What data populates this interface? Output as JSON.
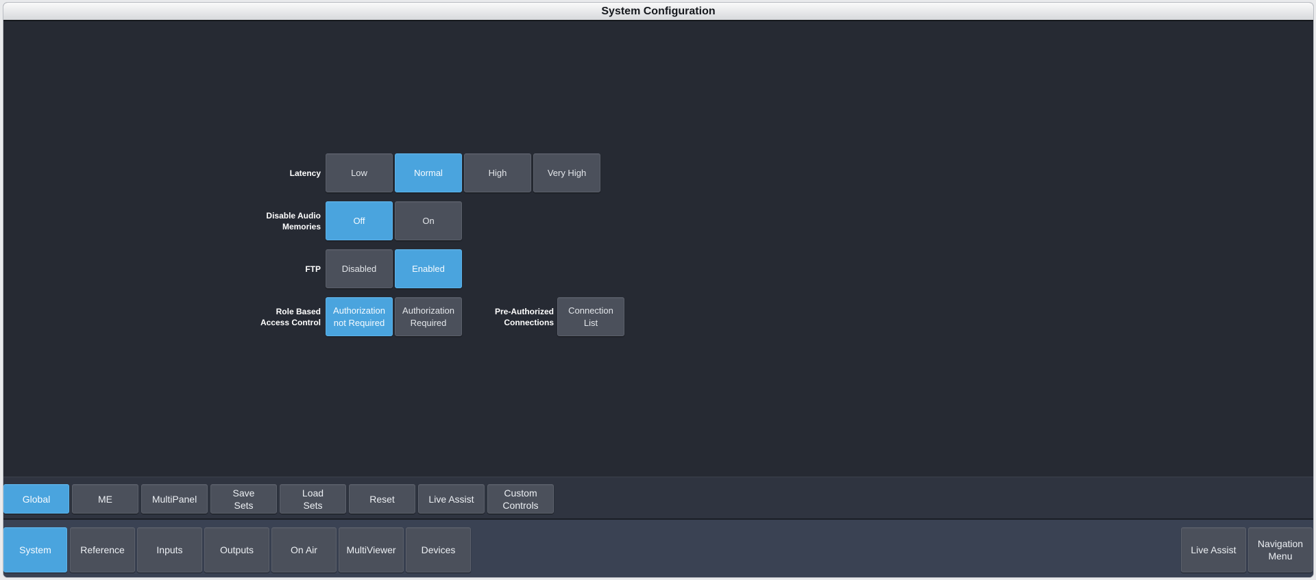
{
  "window": {
    "title": "System Configuration"
  },
  "settings": {
    "latency": {
      "label": "Latency",
      "options": [
        "Low",
        "Normal",
        "High",
        "Very High"
      ],
      "selected": "Normal"
    },
    "audio": {
      "label": "Disable Audio\nMemories",
      "options": [
        "Off",
        "On"
      ],
      "selected": "Off"
    },
    "ftp": {
      "label": "FTP",
      "options": [
        "Disabled",
        "Enabled"
      ],
      "selected": "Enabled"
    },
    "rbac": {
      "label": "Role Based\nAccess Control",
      "options": [
        "Authorization\nnot Required",
        "Authorization\nRequired"
      ],
      "selected": "Authorization\nnot Required"
    },
    "preauth": {
      "label": "Pre-Authorized\nConnections",
      "button": "Connection\nList"
    }
  },
  "subtabs": {
    "items": [
      "Global",
      "ME",
      "MultiPanel",
      "Save\nSets",
      "Load\nSets",
      "Reset",
      "Live Assist",
      "Custom\nControls"
    ],
    "active": "Global"
  },
  "nav": {
    "items": [
      "System",
      "Reference",
      "Inputs",
      "Outputs",
      "On Air",
      "MultiViewer",
      "Devices"
    ],
    "active": "System",
    "right": [
      "Live Assist",
      "Navigation\nMenu"
    ]
  },
  "colors": {
    "active": "#4aa4de",
    "button": "#4b505b",
    "background": "#262a33"
  }
}
